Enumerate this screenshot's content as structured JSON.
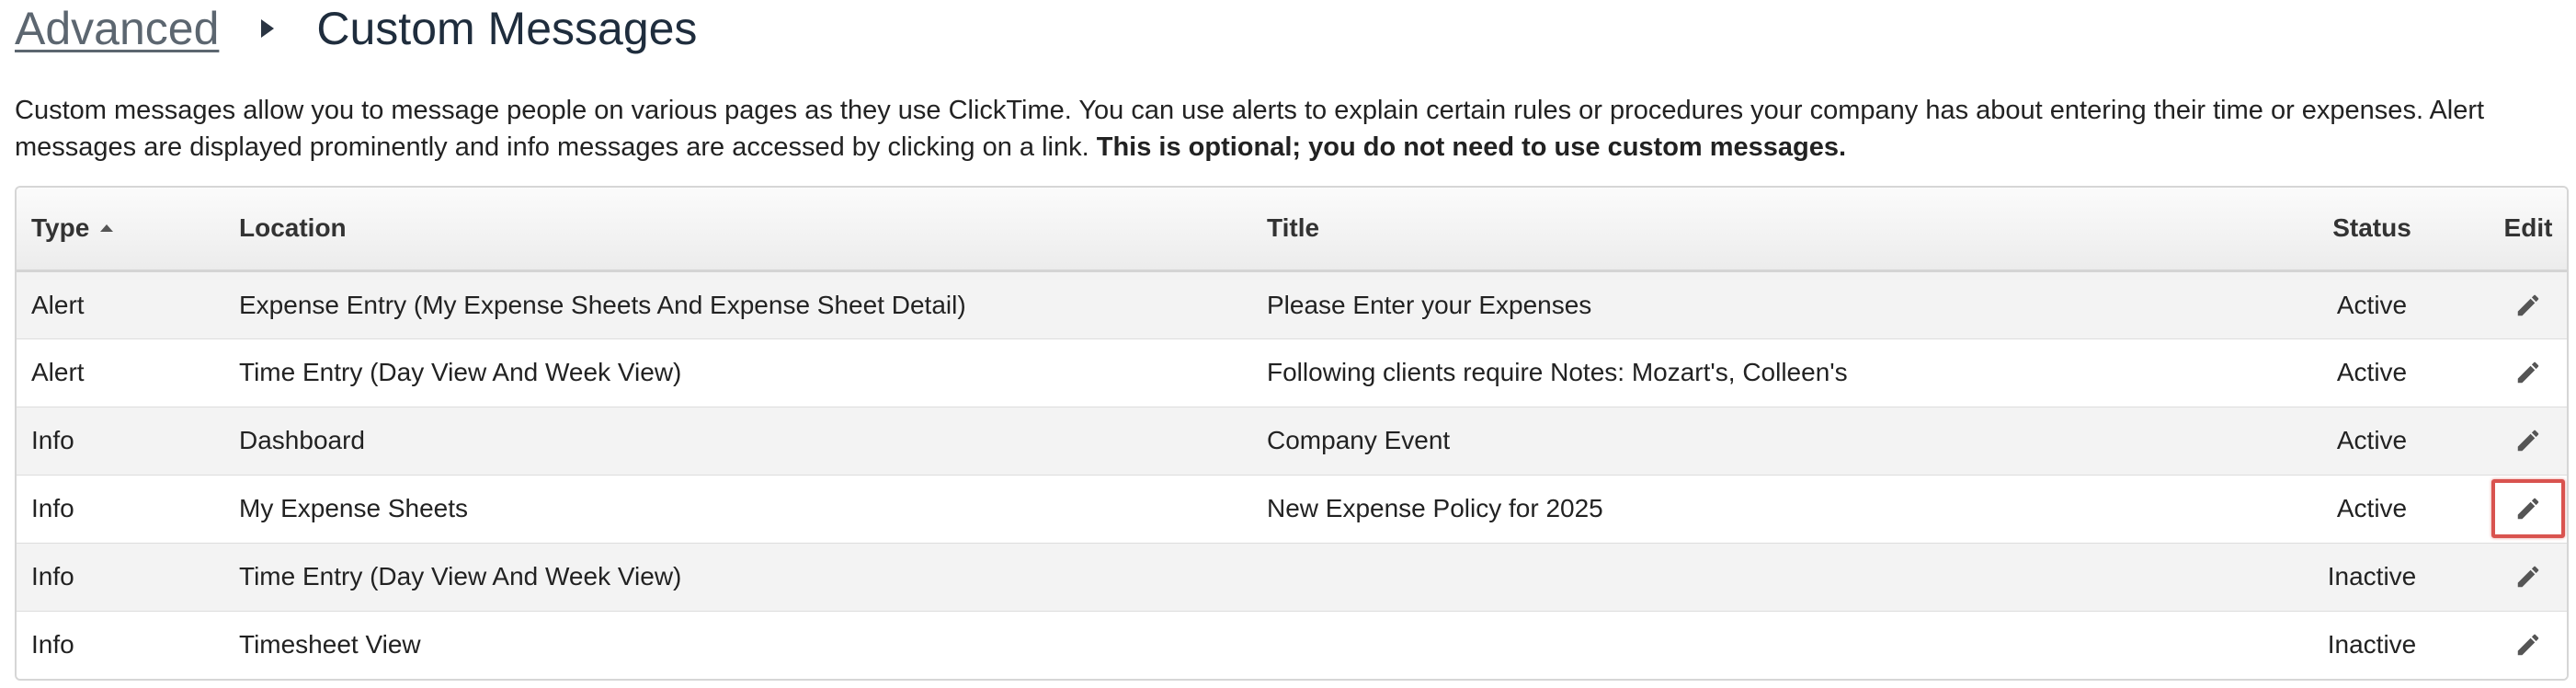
{
  "breadcrumb": {
    "parent": "Advanced",
    "current": "Custom Messages"
  },
  "description": {
    "text": "Custom messages allow you to message people on various pages as they use ClickTime. You can use alerts to explain certain rules or procedures your company has about entering their time or expenses. Alert messages are displayed prominently and info messages are accessed by clicking on a link. ",
    "bold": "This is optional; you do not need to use custom messages."
  },
  "table": {
    "headers": {
      "type": "Type",
      "location": "Location",
      "title": "Title",
      "status": "Status",
      "edit": "Edit"
    },
    "sort": {
      "column": "type",
      "direction": "ascending"
    },
    "rows": [
      {
        "type": "Alert",
        "location": "Expense Entry (My Expense Sheets And Expense Sheet Detail)",
        "title": "Please Enter your Expenses",
        "status": "Active"
      },
      {
        "type": "Alert",
        "location": "Time Entry (Day View And Week View)",
        "title": "Following clients require Notes: Mozart's, Colleen's",
        "status": "Active"
      },
      {
        "type": "Info",
        "location": "Dashboard",
        "title": "Company Event",
        "status": "Active"
      },
      {
        "type": "Info",
        "location": "My Expense Sheets",
        "title": "New Expense Policy for 2025",
        "status": "Active",
        "highlighted": true
      },
      {
        "type": "Info",
        "location": "Time Entry (Day View And Week View)",
        "title": "",
        "status": "Inactive"
      },
      {
        "type": "Info",
        "location": "Timesheet View",
        "title": "",
        "status": "Inactive"
      }
    ]
  },
  "icons": {
    "edit": "pencil-icon",
    "sort": "sort-ascending-icon",
    "separator": "triangle-right-icon"
  },
  "colors": {
    "highlight_border": "#d9534f",
    "breadcrumb_link": "#5c6670",
    "heading": "#1f2d3d"
  }
}
